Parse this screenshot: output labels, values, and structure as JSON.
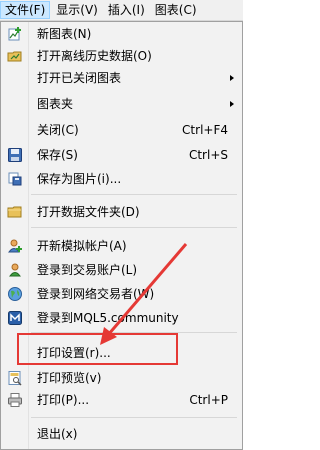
{
  "menubar": {
    "items": [
      "文件(F)",
      "显示(V)",
      "插入(I)",
      "图表(C)"
    ]
  },
  "menu": {
    "items": [
      {
        "label": "新图表(N)",
        "shortcut": "",
        "icon": "new-chart-icon"
      },
      {
        "label": "打开离线历史数据(O)",
        "shortcut": "",
        "icon": "open-offline-icon"
      },
      {
        "label": "打开已关闭图表",
        "shortcut": "",
        "icon": ""
      },
      {
        "label": "图表夹",
        "shortcut": "",
        "icon": ""
      },
      {
        "label": "关闭(C)",
        "shortcut": "Ctrl+F4",
        "icon": ""
      },
      {
        "label": "保存(S)",
        "shortcut": "Ctrl+S",
        "icon": "save-icon"
      },
      {
        "label": "保存为图片(i)...",
        "shortcut": "",
        "icon": "save-picture-icon"
      },
      {
        "label": "打开数据文件夹(D)",
        "shortcut": "",
        "icon": "folder-icon"
      },
      {
        "label": "开新模拟帐户(A)",
        "shortcut": "",
        "icon": "add-user-icon"
      },
      {
        "label": "登录到交易账户(L)",
        "shortcut": "",
        "icon": "user-login-icon"
      },
      {
        "label": "登录到网络交易者(W)",
        "shortcut": "",
        "icon": "globe-icon"
      },
      {
        "label": "登录到MQL5.community",
        "shortcut": "",
        "icon": "mql5-icon"
      },
      {
        "label": "打印设置(r)...",
        "shortcut": "",
        "icon": ""
      },
      {
        "label": "打印预览(v)",
        "shortcut": "",
        "icon": "print-preview-icon"
      },
      {
        "label": "打印(P)...",
        "shortcut": "Ctrl+P",
        "icon": "printer-icon"
      },
      {
        "label": "退出(x)",
        "shortcut": "",
        "icon": ""
      }
    ]
  },
  "colors": {
    "highlight": "#e53935",
    "menu_bg": "#f2f2f2",
    "menubar_active": "#cce8ff"
  }
}
